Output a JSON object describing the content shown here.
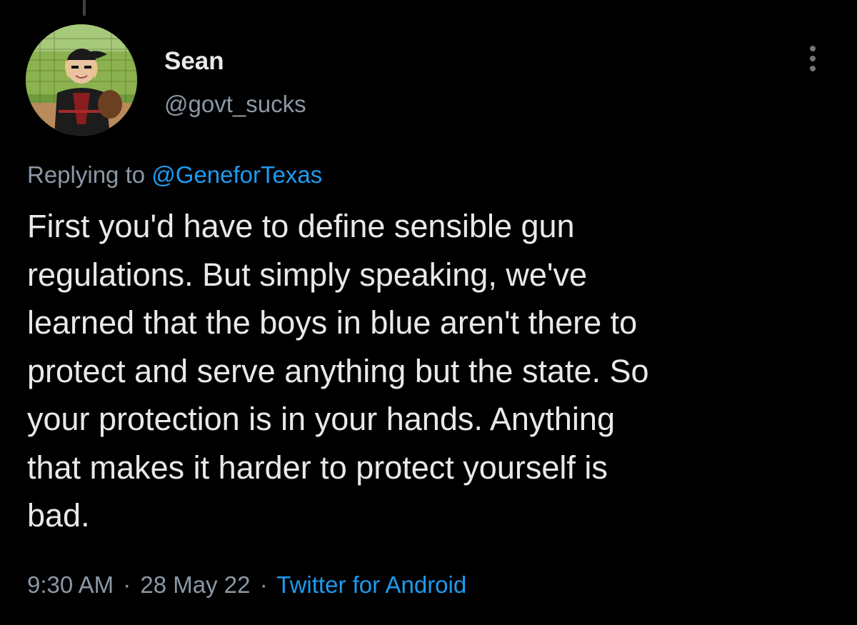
{
  "author": {
    "display_name": "Sean",
    "handle": "@govt_sucks",
    "avatar": "profile photo of child in baseball uniform with cap and glove"
  },
  "menu": {
    "icon": "more-vertical-icon"
  },
  "reply": {
    "prefix": "Replying to",
    "mention": "@GeneforTexas"
  },
  "tweet": {
    "text": "First you'd have to define sensible gun\nregulations. But simply speaking, we've\nlearned that the boys in blue aren't there to\nprotect and serve anything but the state. So\nyour protection is in your hands. Anything\nthat makes it harder to protect yourself is\nbad."
  },
  "meta": {
    "time": "9:30 AM",
    "separator": "·",
    "date": "28 May 22",
    "source": "Twitter for Android"
  },
  "colors": {
    "background": "#000000",
    "text": "#e7e9ea",
    "secondary": "#8b98a5",
    "accent": "#1d9bf0"
  }
}
